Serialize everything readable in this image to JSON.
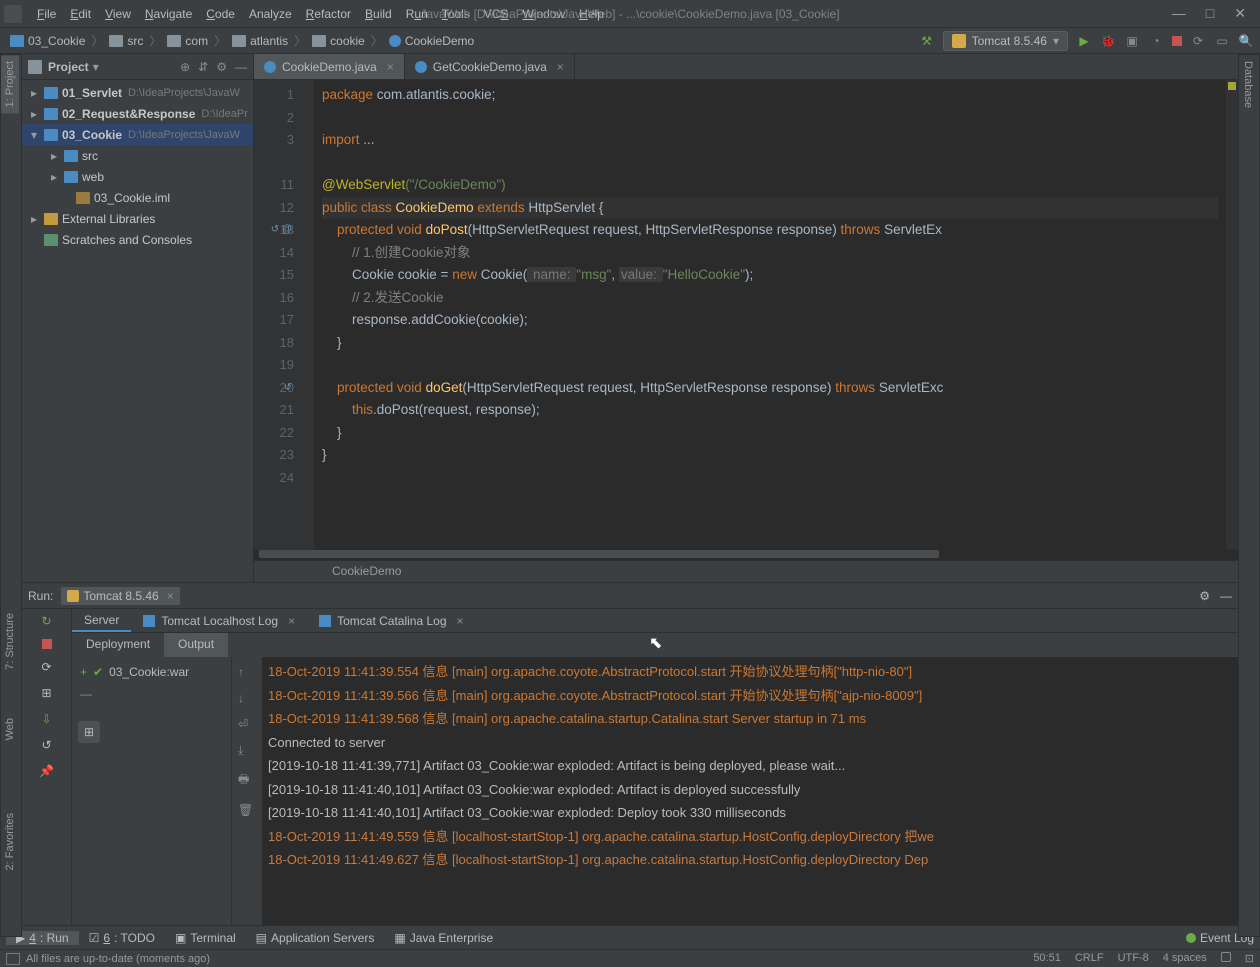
{
  "window": {
    "title": "JavaWeb [D:\\IdeaProjects\\JavaWeb] - ...\\cookie\\CookieDemo.java [03_Cookie]"
  },
  "menu": {
    "file": "File",
    "edit": "Edit",
    "view": "View",
    "navigate": "Navigate",
    "code": "Code",
    "analyze": "Analyze",
    "refactor": "Refactor",
    "build": "Build",
    "run": "Run",
    "tools": "Tools",
    "vcs": "VCS",
    "window": "Window",
    "help": "Help"
  },
  "breadcrumb": {
    "b0": "03_Cookie",
    "b1": "src",
    "b2": "com",
    "b3": "atlantis",
    "b4": "cookie",
    "b5": "CookieDemo"
  },
  "runconfig": {
    "name": "Tomcat 8.5.46"
  },
  "left_stripe": {
    "project": "1: Project",
    "structure": "7: Structure",
    "web": "Web",
    "favorites": "2: Favorites"
  },
  "right_stripe": {
    "database": "Database"
  },
  "project_panel": {
    "title": "Project",
    "items": {
      "n0": "01_Servlet",
      "p0": "D:\\IdeaProjects\\JavaW",
      "n1": "02_Request&Response",
      "p1": "D:\\IdeaPr",
      "n2": "03_Cookie",
      "p2": "D:\\IdeaProjects\\JavaW",
      "n3": "src",
      "n4": "web",
      "n5": "03_Cookie.iml",
      "n6": "External Libraries",
      "n7": "Scratches and Consoles"
    }
  },
  "editor_tabs": {
    "t0": "CookieDemo.java",
    "t1": "GetCookieDemo.java"
  },
  "editor_crumb": "CookieDemo",
  "gutter": {
    "l1": "1",
    "l2": "2",
    "l3": "3",
    "l4": " ",
    "l5": "11",
    "l6": "12",
    "l7": "13",
    "l8": "14",
    "l9": "15",
    "l10": "16",
    "l11": "17",
    "l12": "18",
    "l13": "19",
    "l14": "20",
    "l15": "21",
    "l16": "22",
    "l17": "23",
    "l18": "24"
  },
  "code": {
    "pkg_kw": "package",
    "pkg": " com.atlantis.cookie;",
    "imp_kw": "import",
    "imp": " ...",
    "ann": "@WebServlet",
    "ann_arg": "(\"/CookieDemo\")",
    "pub": "public ",
    "cls": "class ",
    "clsname": "CookieDemo",
    "ext": " extends ",
    "sup": "HttpServlet",
    " brace": " {",
    "prot": "    protected ",
    "void": "void ",
    "doPost": "doPost",
    "doGet": "doGet",
    "sig1": "(HttpServletRequest request, HttpServletResponse response) ",
    "throws": "throws",
    "exc": " ServletEx",
    "cmt1": "        // 1.创建Cookie对象",
    "ck_line_a": "        Cookie cookie = ",
    "new": "new",
    "ck_line_b": " Cookie(",
    "hint1": " name: ",
    "str1": "\"msg\"",
    "comma": ", ",
    "hint2": "value: ",
    "str2": "\"HelloCookie\"",
    "ck_line_c": ");",
    "cmt2": "        // 2.发送Cookie",
    "resp": "        response.addCookie(cookie);",
    "close1": "    }",
    "sig2": "(HttpServletRequest request, HttpServletResponse response) ",
    "exc2": " ServletExc",
    "this": "        this",
    "doPostCall": ".doPost(request, response);",
    "close2": "    }",
    "close3": "}"
  },
  "run": {
    "label": "Run:",
    "config": "Tomcat 8.5.46",
    "tab_server": "Server",
    "tab_local": "Tomcat Localhost Log",
    "tab_catalina": "Tomcat Catalina Log",
    "tab_deploy": "Deployment",
    "tab_output": "Output",
    "artifact": "03_Cookie:war"
  },
  "console": {
    "l1": "18-Oct-2019 11:41:39.554 信息 [main] org.apache.coyote.AbstractProtocol.start 开始协议处理句柄[\"http-nio-80\"]",
    "l2": "18-Oct-2019 11:41:39.566 信息 [main] org.apache.coyote.AbstractProtocol.start 开始协议处理句柄[\"ajp-nio-8009\"]",
    "l3": "18-Oct-2019 11:41:39.568 信息 [main] org.apache.catalina.startup.Catalina.start Server startup in 71 ms",
    "l4": "Connected to server",
    "l5": "[2019-10-18 11:41:39,771] Artifact 03_Cookie:war exploded: Artifact is being deployed, please wait...",
    "l6": "[2019-10-18 11:41:40,101] Artifact 03_Cookie:war exploded: Artifact is deployed successfully",
    "l7": "[2019-10-18 11:41:40,101] Artifact 03_Cookie:war exploded: Deploy took 330 milliseconds",
    "l8": "18-Oct-2019 11:41:49.559 信息 [localhost-startStop-1] org.apache.catalina.startup.HostConfig.deployDirectory 把we",
    "l9": "18-Oct-2019 11:41:49.627 信息 [localhost-startStop-1] org.apache.catalina.startup.HostConfig.deployDirectory Dep"
  },
  "bottom": {
    "run": "4: Run",
    "todo": "6: TODO",
    "terminal": "Terminal",
    "appservers": "Application Servers",
    "javaee": "Java Enterprise",
    "eventlog": "Event Log"
  },
  "status": {
    "msg": "All files are up-to-date (moments ago)",
    "pos": "50:51",
    "eol": "CRLF",
    "enc": "UTF-8",
    "indent": "4 spaces"
  }
}
